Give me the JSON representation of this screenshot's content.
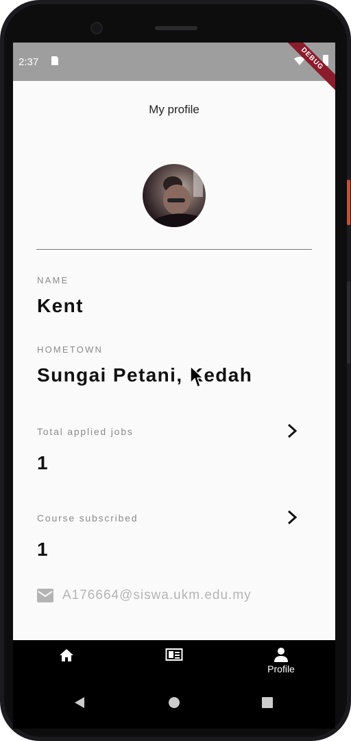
{
  "status_bar": {
    "time": "2:37",
    "debug_banner": "DEBUG"
  },
  "app_bar": {
    "title": "My profile"
  },
  "profile": {
    "name_label": "NAME",
    "name": "Kent",
    "hometown_label": "HOMETOWN",
    "hometown": "Sungai Petani, Kedah"
  },
  "stats": {
    "applied_jobs_label": "Total applied jobs",
    "applied_jobs_count": "1",
    "course_label": "Course subscribed",
    "course_count": "1"
  },
  "contact": {
    "email": "A176664@siswa.ukm.edu.my"
  },
  "bottom_nav": {
    "items": [
      {
        "icon": "home-icon",
        "label": ""
      },
      {
        "icon": "article-icon",
        "label": ""
      },
      {
        "icon": "person-icon",
        "label": "Profile"
      }
    ]
  },
  "colors": {
    "status_bar": "#9e9e9e",
    "background": "#fafafa",
    "nav_background": "#000000",
    "debug_banner": "#8b1c2c"
  }
}
